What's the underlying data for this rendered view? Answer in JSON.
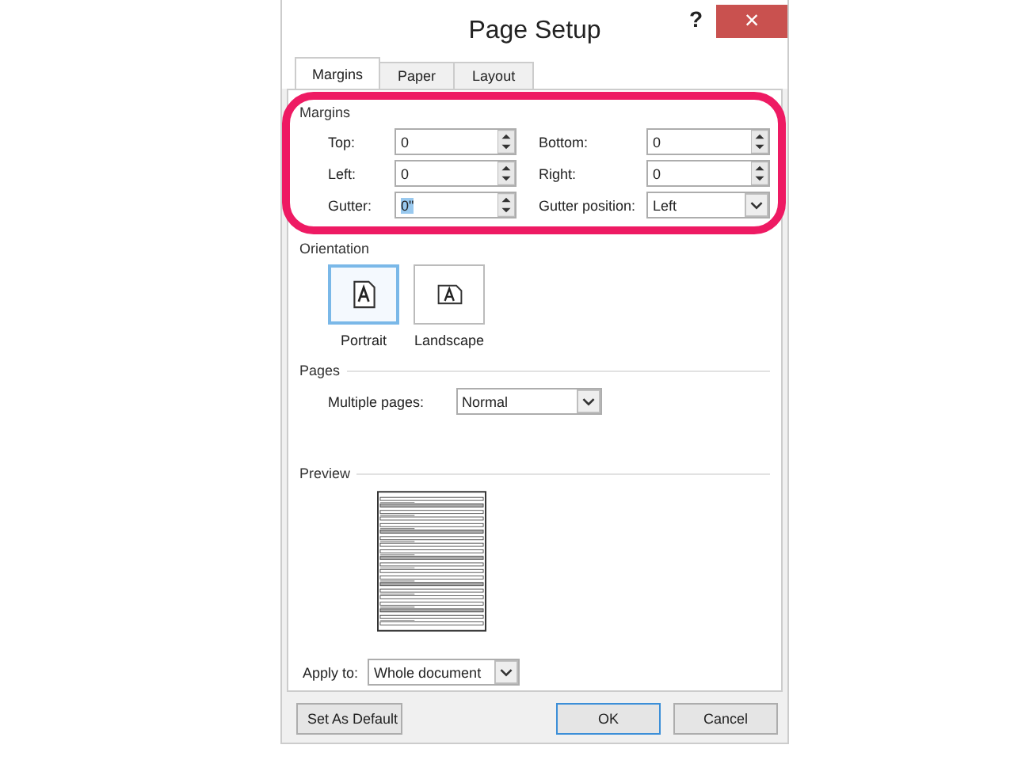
{
  "window": {
    "title": "Page Setup",
    "help": "?",
    "close": "×"
  },
  "tabs": [
    {
      "label": "Margins",
      "selected": true
    },
    {
      "label": "Paper",
      "selected": false
    },
    {
      "label": "Layout",
      "selected": false
    }
  ],
  "margins": {
    "label": "Margins",
    "fields": [
      {
        "kind": "spin",
        "label": "Top:",
        "value": "0",
        "highlighted": false
      },
      {
        "kind": "spin",
        "label": "Bottom:",
        "value": "0",
        "highlighted": false
      },
      {
        "kind": "spin",
        "label": "Left:",
        "value": "0",
        "highlighted": false
      },
      {
        "kind": "spin",
        "label": "Right:",
        "value": "0",
        "highlighted": false
      },
      {
        "kind": "spin",
        "label": "Gutter:",
        "value": "0\"",
        "highlighted": true
      },
      {
        "kind": "dropdown",
        "label": "Gutter position:",
        "value": "Left",
        "highlighted": false
      }
    ]
  },
  "orientation": {
    "label": "Orientation",
    "options": [
      {
        "kind": "portrait",
        "label": "Portrait",
        "selected": true
      },
      {
        "kind": "landscape",
        "label": "Landscape",
        "selected": false
      }
    ]
  },
  "pages": {
    "label": "Pages",
    "multiple_pages": {
      "label": "Multiple pages:",
      "value": "Normal"
    }
  },
  "preview": {
    "label": "Preview",
    "apply_to": {
      "label": "Apply to:",
      "value": "Whole document"
    }
  },
  "buttons": [
    {
      "label": "Set As Default",
      "default": false
    },
    {
      "label": "OK",
      "default": true
    },
    {
      "label": "Cancel",
      "default": false
    }
  ]
}
